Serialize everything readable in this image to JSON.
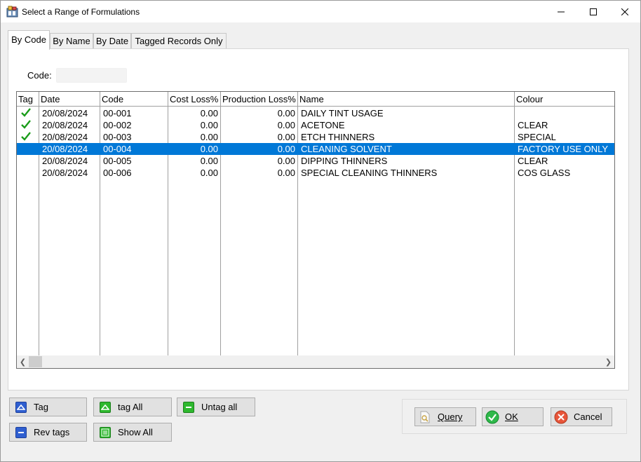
{
  "window": {
    "title": "Select a Range of Formulations"
  },
  "tabs": [
    {
      "label": "By Code",
      "active": true
    },
    {
      "label": "By Name",
      "active": false
    },
    {
      "label": "By Date",
      "active": false
    },
    {
      "label": "Tagged Records Only",
      "active": false
    }
  ],
  "filter": {
    "code_label": "Code:",
    "code_value": ""
  },
  "grid": {
    "columns": [
      "Tag",
      "Date",
      "Code",
      "Cost Loss%",
      "Production Loss%",
      "Name",
      "Colour"
    ],
    "rows": [
      {
        "tagged": true,
        "date": "20/08/2024",
        "code": "00-001",
        "cost_loss": "0.00",
        "production_loss": "0.00",
        "name": "DAILY TINT USAGE",
        "colour": "",
        "selected": false
      },
      {
        "tagged": true,
        "date": "20/08/2024",
        "code": "00-002",
        "cost_loss": "0.00",
        "production_loss": "0.00",
        "name": "ACETONE",
        "colour": "CLEAR",
        "selected": false
      },
      {
        "tagged": true,
        "date": "20/08/2024",
        "code": "00-003",
        "cost_loss": "0.00",
        "production_loss": "0.00",
        "name": "ETCH THINNERS",
        "colour": "SPECIAL",
        "selected": false
      },
      {
        "tagged": false,
        "date": "20/08/2024",
        "code": "00-004",
        "cost_loss": "0.00",
        "production_loss": "0.00",
        "name": "CLEANING SOLVENT",
        "colour": "FACTORY USE ONLY",
        "selected": true
      },
      {
        "tagged": false,
        "date": "20/08/2024",
        "code": "00-005",
        "cost_loss": "0.00",
        "production_loss": "0.00",
        "name": "DIPPING THINNERS",
        "colour": "CLEAR",
        "selected": false
      },
      {
        "tagged": false,
        "date": "20/08/2024",
        "code": "00-006",
        "cost_loss": "0.00",
        "production_loss": "0.00",
        "name": "SPECIAL CLEANING THINNERS",
        "colour": "COS GLASS",
        "selected": false
      }
    ]
  },
  "buttons": {
    "tag": "Tag",
    "tag_all": "tag All",
    "untag_all": "Untag all",
    "rev_tags": "Rev tags",
    "show_all": "Show All",
    "query": "Query",
    "ok": "OK",
    "cancel": "Cancel"
  },
  "colors": {
    "selection": "#0078d7",
    "check": "#1a9c1a"
  }
}
